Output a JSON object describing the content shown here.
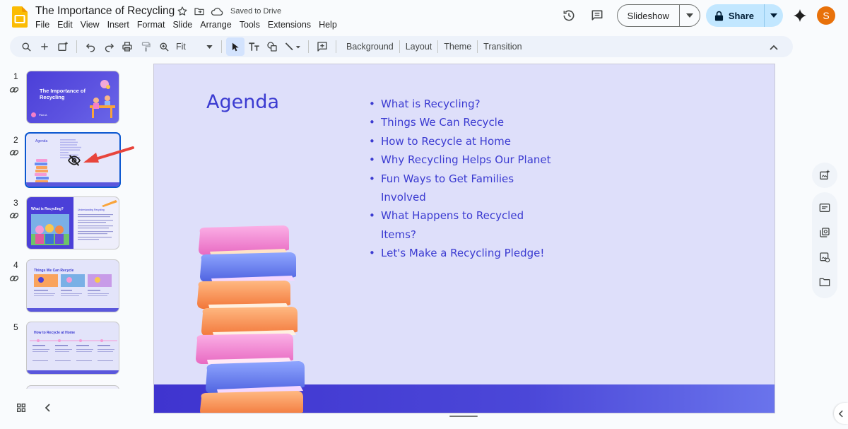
{
  "app": {
    "title": "The Importance of Recycling",
    "saved_status": "Saved to Drive"
  },
  "menu": [
    "File",
    "Edit",
    "View",
    "Insert",
    "Format",
    "Slide",
    "Arrange",
    "Tools",
    "Extensions",
    "Help"
  ],
  "header": {
    "slideshow_label": "Slideshow",
    "share_label": "Share",
    "avatar_letter": "S"
  },
  "toolbar": {
    "zoom_value": "Fit",
    "background_label": "Background",
    "layout_label": "Layout",
    "theme_label": "Theme",
    "transition_label": "Transition"
  },
  "filmstrip": {
    "slides": [
      {
        "number": "1",
        "title": "The Importance of Recycling",
        "footer": "Plan A"
      },
      {
        "number": "2",
        "title": "Agenda",
        "hidden": true
      },
      {
        "number": "3",
        "title": "What is Recycling?",
        "subtitle": "Understanding Recycling"
      },
      {
        "number": "4",
        "title": "Things We Can Recycle"
      },
      {
        "number": "5",
        "title": "How to Recycle at Home"
      }
    ]
  },
  "slide": {
    "title": "Agenda",
    "items": [
      "What is Recycling?",
      "Things We Can Recycle",
      "How to Recycle at Home",
      "Why Recycling Helps Our Planet",
      "Fun Ways to Get Families Involved",
      "What Happens to Recycled Items?",
      "Let's Make a Recycling Pledge!"
    ]
  },
  "colors": {
    "accent": "#3b3bd1",
    "slide_bg": "#dedffa",
    "share_bg": "#c2e7ff",
    "avatar": "#e8710a",
    "selection": "#0b57d0",
    "arrow": "#e8453c"
  }
}
